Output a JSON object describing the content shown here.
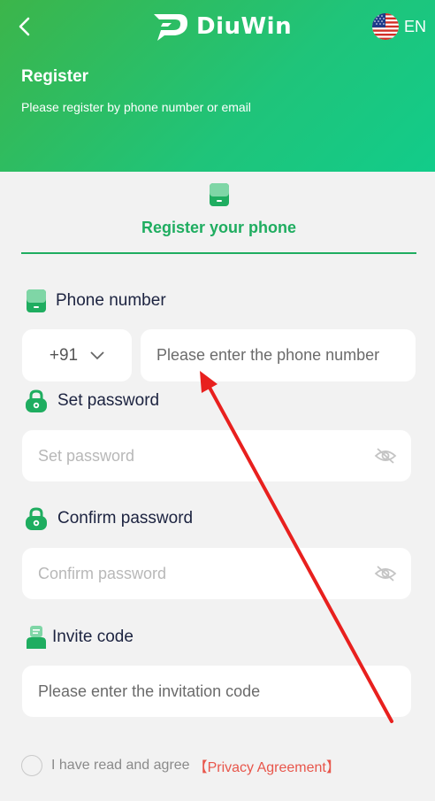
{
  "header": {
    "brand": "DiuWin",
    "language": "EN",
    "title": "Register",
    "subtitle": "Please register by phone number or email"
  },
  "tab": {
    "label": "Register your phone"
  },
  "phone": {
    "label": "Phone number",
    "country_code": "+91",
    "placeholder": "Please enter the phone number"
  },
  "password": {
    "label": "Set password",
    "placeholder": "Set password"
  },
  "confirm": {
    "label": "Confirm password",
    "placeholder": "Confirm password"
  },
  "invite": {
    "label": "Invite code",
    "placeholder": "Please enter the invitation code"
  },
  "agreement": {
    "text": "I have read and agree",
    "link": "【Privacy Agreement】"
  },
  "colors": {
    "brand_green": "#1fad60",
    "header_gradient_start": "#3cb54a",
    "header_gradient_end": "#12cc8a",
    "link_red": "#e8564b",
    "annotation_arrow": "#e8201e"
  },
  "icons": [
    "back-arrow-icon",
    "brand-logo-icon",
    "us-flag-icon",
    "phone-icon",
    "chevron-down-icon",
    "lock-icon",
    "eye-slash-icon",
    "invite-code-icon"
  ]
}
